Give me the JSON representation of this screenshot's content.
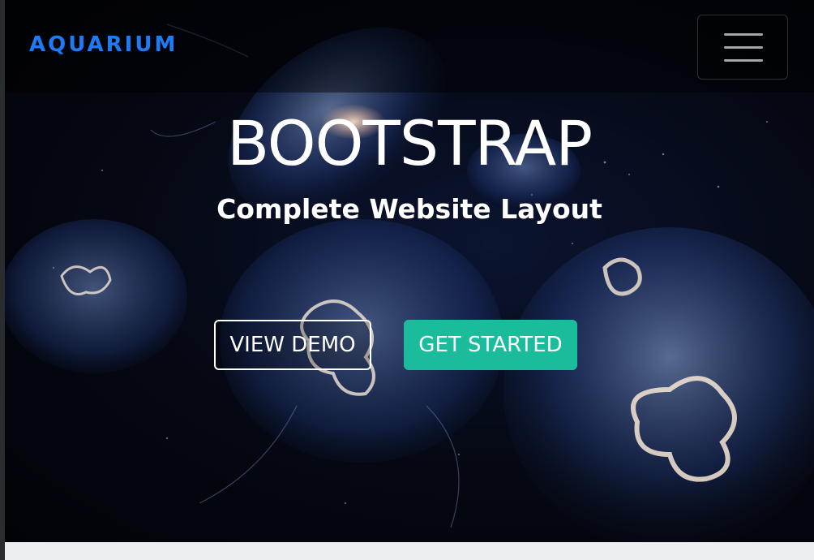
{
  "navbar": {
    "brand": "AQUARIUM",
    "menu_icon": "hamburger-menu-icon"
  },
  "hero": {
    "title": "BOOTSTRAP",
    "subtitle": "Complete Website Layout",
    "background_image": "jellyfish-underwater"
  },
  "buttons": {
    "view_demo": "VIEW DEMO",
    "get_started": "GET STARTED"
  },
  "colors": {
    "brand": "#1e7bf5",
    "accent": "#1bbc9b",
    "footer_strip": "#eceff1"
  }
}
